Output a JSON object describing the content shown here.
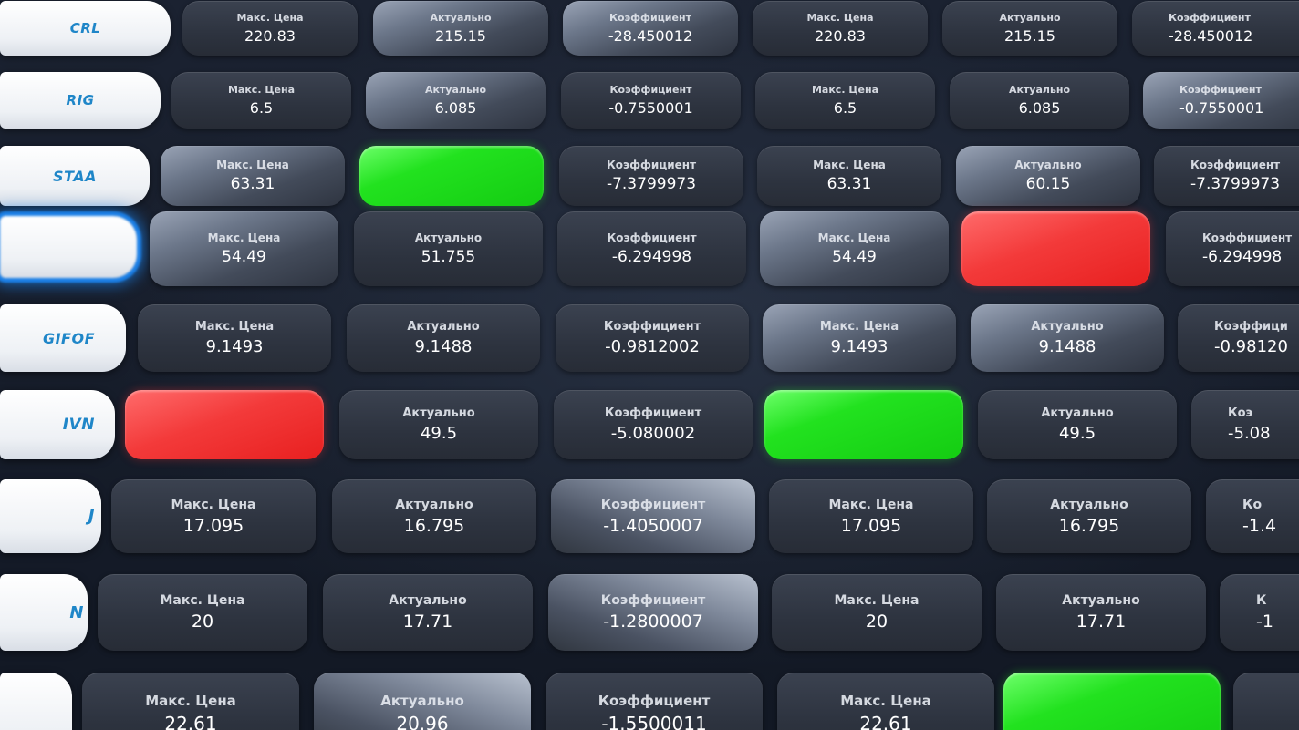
{
  "rows": [
    {
      "ticker": "CRL",
      "cells": [
        {
          "label": "Макс. Цена",
          "value": "220.83",
          "state": "normal"
        },
        {
          "label": "Актуально",
          "value": "215.15",
          "state": "highlight"
        },
        {
          "label": "Коэффициент",
          "value": "-28.450012",
          "state": "highlight"
        },
        {
          "label": "Макс. Цена",
          "value": "220.83",
          "state": "normal"
        },
        {
          "label": "Актуально",
          "value": "215.15",
          "state": "normal"
        },
        {
          "label": "Коэффициент",
          "value": "-28.450012",
          "state": "normal"
        }
      ]
    },
    {
      "ticker": "RIG",
      "cells": [
        {
          "label": "Макс. Цена",
          "value": "6.5",
          "state": "normal"
        },
        {
          "label": "Актуально",
          "value": "6.085",
          "state": "highlight"
        },
        {
          "label": "Коэффициент",
          "value": "-0.7550001",
          "state": "normal"
        },
        {
          "label": "Макс. Цена",
          "value": "6.5",
          "state": "normal"
        },
        {
          "label": "Актуально",
          "value": "6.085",
          "state": "normal"
        },
        {
          "label": "Коэффициент",
          "value": "-0.7550001",
          "state": "highlight"
        }
      ]
    },
    {
      "ticker": "STAA",
      "cells": [
        {
          "label": "Макс. Цена",
          "value": "63.31",
          "state": "highlight"
        },
        {
          "label": "",
          "value": "",
          "state": "green"
        },
        {
          "label": "Коэффициент",
          "value": "-7.3799973",
          "state": "normal"
        },
        {
          "label": "Макс. Цена",
          "value": "63.31",
          "state": "normal"
        },
        {
          "label": "Актуально",
          "value": "60.15",
          "state": "highlight"
        },
        {
          "label": "Коэффициент",
          "value": "-7.3799973",
          "state": "normal"
        }
      ]
    },
    {
      "ticker": "",
      "focused": true,
      "cells": [
        {
          "label": "Макс. Цена",
          "value": "54.49",
          "state": "highlight"
        },
        {
          "label": "Актуально",
          "value": "51.755",
          "state": "normal"
        },
        {
          "label": "Коэффициент",
          "value": "-6.294998",
          "state": "normal"
        },
        {
          "label": "Макс. Цена",
          "value": "54.49",
          "state": "highlight"
        },
        {
          "label": "",
          "value": "",
          "state": "red"
        },
        {
          "label": "Коэффициент",
          "value": "-6.294998",
          "state": "normal"
        }
      ]
    },
    {
      "ticker": "GIFOF",
      "cells": [
        {
          "label": "Макс. Цена",
          "value": "9.1493",
          "state": "normal"
        },
        {
          "label": "Актуально",
          "value": "9.1488",
          "state": "normal"
        },
        {
          "label": "Коэффициент",
          "value": "-0.9812002",
          "state": "normal"
        },
        {
          "label": "Макс. Цена",
          "value": "9.1493",
          "state": "highlight"
        },
        {
          "label": "Актуально",
          "value": "9.1488",
          "state": "highlight"
        },
        {
          "label": "Коэффици",
          "value": "-0.98120",
          "state": "normal"
        }
      ]
    },
    {
      "ticker": "IVN",
      "cells": [
        {
          "label": "",
          "value": "",
          "state": "red"
        },
        {
          "label": "Актуально",
          "value": "49.5",
          "state": "normal"
        },
        {
          "label": "Коэффициент",
          "value": "-5.080002",
          "state": "normal"
        },
        {
          "label": "",
          "value": "",
          "state": "green"
        },
        {
          "label": "Актуально",
          "value": "49.5",
          "state": "normal"
        },
        {
          "label": "Коэ",
          "value": "-5.08",
          "state": "normal"
        }
      ]
    },
    {
      "ticker": "J",
      "cells": [
        {
          "label": "Макс. Цена",
          "value": "17.095",
          "state": "normal"
        },
        {
          "label": "Актуально",
          "value": "16.795",
          "state": "normal"
        },
        {
          "label": "Коэффициент",
          "value": "-1.4050007",
          "state": "highlight2"
        },
        {
          "label": "Макс. Цена",
          "value": "17.095",
          "state": "normal"
        },
        {
          "label": "Актуально",
          "value": "16.795",
          "state": "normal"
        },
        {
          "label": "Ко",
          "value": "-1.4",
          "state": "normal"
        }
      ]
    },
    {
      "ticker": "N",
      "cells": [
        {
          "label": "Макс. Цена",
          "value": "20",
          "state": "normal"
        },
        {
          "label": "Актуально",
          "value": "17.71",
          "state": "normal"
        },
        {
          "label": "Коэффициент",
          "value": "-1.2800007",
          "state": "highlight2"
        },
        {
          "label": "Макс. Цена",
          "value": "20",
          "state": "normal"
        },
        {
          "label": "Актуально",
          "value": "17.71",
          "state": "normal"
        },
        {
          "label": "К",
          "value": "-1",
          "state": "normal"
        }
      ]
    },
    {
      "ticker": "",
      "cells": [
        {
          "label": "Макс. Цена",
          "value": "22.61",
          "state": "normal"
        },
        {
          "label": "Актуально",
          "value": "20.96",
          "state": "highlight2"
        },
        {
          "label": "Коэффициент",
          "value": "-1.5500011",
          "state": "normal"
        },
        {
          "label": "Макс. Цена",
          "value": "22.61",
          "state": "normal"
        },
        {
          "label": "",
          "value": "",
          "state": "green"
        },
        {
          "label": "",
          "value": "",
          "state": "normal"
        }
      ]
    }
  ],
  "colors": {
    "background": "#141a26",
    "ticker_text": "#1f86c8",
    "ticker_bg": "#ffffff",
    "cell_bg": "#2d333f",
    "green": "#22e21f",
    "red": "#f33a3a",
    "focus_ring": "#1b7fe6"
  }
}
